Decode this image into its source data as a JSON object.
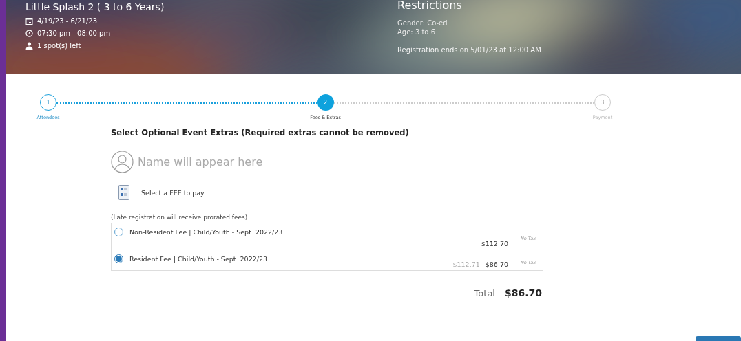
{
  "event": {
    "title": "Little Splash 2 ( 3 to 6 Years)",
    "dates": "4/19/23 - 6/21/23",
    "time": "07:30 pm - 08:00 pm",
    "spots": "1 spot(s) left"
  },
  "restrictions": {
    "title": "Restrictions",
    "lines": [
      "Gender: Co-ed",
      "Age: 3 to 6"
    ],
    "registration": "Registration ends on 5/01/23 at 12:00 AM"
  },
  "steps": [
    {
      "number": "1",
      "label": "Attendees",
      "completed": true,
      "selected": false
    },
    {
      "number": "2",
      "label": "Fees & Extras",
      "completed": false,
      "selected": true
    },
    {
      "number": "3",
      "label": "Payment",
      "completed": false,
      "selected": false
    }
  ],
  "extras": {
    "heading": "Select Optional Event Extras (Required extras cannot be removed)",
    "attendee_name": "Name will appear here",
    "fee_prompt": "Select a FEE to pay",
    "note": "(Late registration will receive prorated fees)",
    "fees": [
      {
        "name": "Non-Resident Fee | Child/Youth - Sept. 2022/23",
        "price": "$112.70",
        "tax": "No Tax",
        "selected": false
      },
      {
        "name": "Resident Fee | Child/Youth - Sept. 2022/23",
        "original_price": "$112.71",
        "price": "$86.70",
        "tax": "No Tax",
        "selected": true
      }
    ],
    "total_label": "Total",
    "total": "$86.70"
  }
}
